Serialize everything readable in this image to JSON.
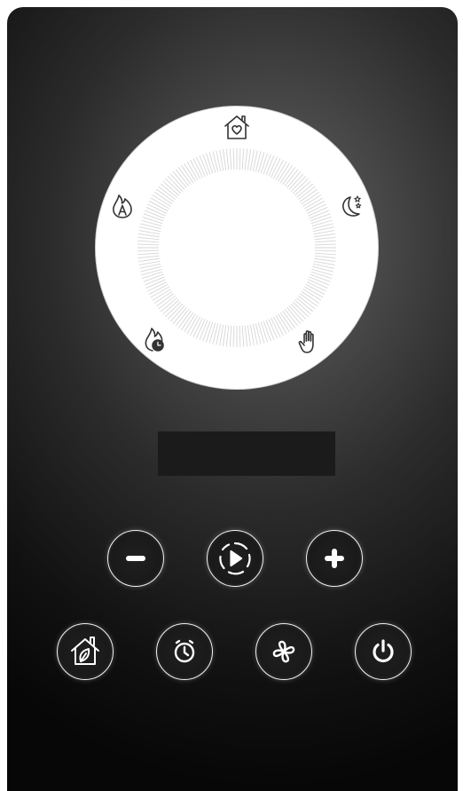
{
  "app": {
    "colors": {
      "device_dark": "#0b0b0b",
      "device_light": "#6d6d6d",
      "dial_face": "#ffffff",
      "icon_stroke": "#333333",
      "button_stroke": "#ffffff"
    }
  },
  "dial": {
    "modes": [
      {
        "id": "home",
        "icon": "home-heart-icon"
      },
      {
        "id": "night",
        "icon": "moon-stars-icon"
      },
      {
        "id": "manual",
        "icon": "hand-icon"
      },
      {
        "id": "boost",
        "icon": "flame-timer-icon"
      },
      {
        "id": "auto",
        "icon": "flame-a-icon"
      }
    ]
  },
  "display": {
    "text": ""
  },
  "controls": {
    "row1": [
      {
        "id": "minus",
        "icon": "minus-icon"
      },
      {
        "id": "play",
        "icon": "play-circle-icon"
      },
      {
        "id": "plus",
        "icon": "plus-icon"
      }
    ],
    "row2": [
      {
        "id": "eco_home",
        "icon": "eco-home-icon"
      },
      {
        "id": "timer",
        "icon": "clock-icon"
      },
      {
        "id": "fan",
        "icon": "fan-icon"
      },
      {
        "id": "power",
        "icon": "power-icon"
      }
    ]
  }
}
